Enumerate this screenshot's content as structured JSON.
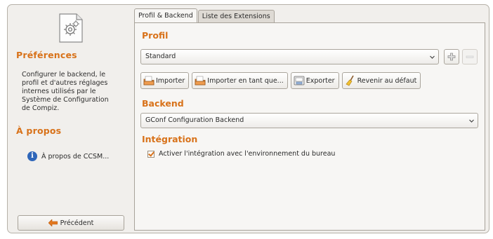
{
  "sidebar": {
    "preferences_title": "Préférences",
    "preferences_desc": "Configurer le backend, le profil et d'autres réglages internes utilisés par le Système de Configuration de Compiz.",
    "about_title": "À propos",
    "about_link": "À propos de CCSM...",
    "back_button": "Précédent",
    "icons": {
      "category": "preferences-gear-icon",
      "about": "info-icon",
      "back": "back-arrow-icon"
    }
  },
  "tabs": [
    {
      "label": "Profil & Backend",
      "active": true
    },
    {
      "label": "Liste des Extensions",
      "active": false
    }
  ],
  "profile": {
    "title": "Profil",
    "selected": "Standard",
    "add_icon": "add-icon",
    "remove_icon": "remove-icon",
    "buttons": {
      "import": "Importer",
      "import_as": "Importer en tant que...",
      "export": "Exporter",
      "reset": "Revenir au défaut"
    }
  },
  "backend": {
    "title": "Backend",
    "selected": "GConf Configuration Backend"
  },
  "integration": {
    "title": "Intégration",
    "checkbox_label": "Activer l'intégration avec l'environnement du bureau",
    "checked": true
  },
  "colors": {
    "accent": "#d8721a",
    "info_blue": "#2f66b9"
  }
}
